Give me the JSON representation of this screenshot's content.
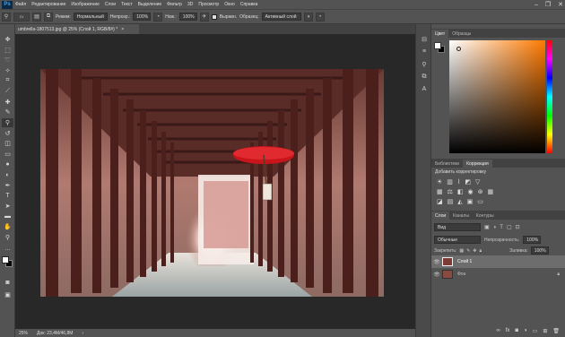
{
  "menubar": {
    "logo": "Ps",
    "items": [
      "Файл",
      "Редактирование",
      "Изображение",
      "Слои",
      "Текст",
      "Выделение",
      "Фильтр",
      "3D",
      "Просмотр",
      "Окно",
      "Справка"
    ]
  },
  "window_controls": {
    "minimize": "–",
    "maximize": "❐",
    "close": "✕"
  },
  "options": {
    "brush_size": "21",
    "mode_label": "Режим:",
    "mode_value": "Нормальный",
    "opacity_label": "Непрозр.:",
    "opacity_value": "100%",
    "flow_label": "Наж.:",
    "flow_value": "100%",
    "aligned_label": "Выравн.",
    "sample_label": "Образец:",
    "sample_value": "Активный слой"
  },
  "document": {
    "tab_title": "umbrella-1807513.jpg @ 25% (Слой 1, RGB/8#) *",
    "tab_close": "×",
    "zoom": "25%",
    "doc_info": "Док: 23,4M/46,8M",
    "status_arrow": "›"
  },
  "color_panel": {
    "tabs": [
      "Цвет",
      "Образцы"
    ],
    "active_tab": 0
  },
  "adjust_panel": {
    "tabs": [
      "Библиотеки",
      "Коррекция"
    ],
    "active_tab": 1,
    "heading": "Добавить корректировку"
  },
  "layers_panel": {
    "tabs": [
      "Слои",
      "Каналы",
      "Контуры"
    ],
    "active_tab": 0,
    "filter_placeholder": "Вид",
    "blend_mode": "Обычные",
    "opacity_label": "Непрозрачность:",
    "opacity_value": "100%",
    "lock_label": "Закрепить:",
    "fill_label": "Заливка:",
    "fill_value": "100%",
    "layers": [
      {
        "name": "Слой 1",
        "selected": true,
        "visible": true,
        "locked": false
      },
      {
        "name": "Фон",
        "selected": false,
        "visible": true,
        "locked": true
      }
    ]
  },
  "colors": {
    "foreground": "#ffffff",
    "background": "#000000",
    "hue_color": "#ff7a00",
    "brand_blue": "#31a8ff"
  }
}
